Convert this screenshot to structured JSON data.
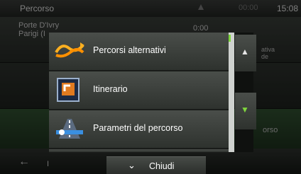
{
  "status_bar": {
    "title": "Percorso",
    "time": "15:08",
    "distance": "00:00"
  },
  "background": {
    "origin_line1": "Porte D'Ivry",
    "origin_line2": "Parigi (I",
    "time_value": "0:00",
    "side_text_1a": "ativa",
    "side_text_1b": "de",
    "side_text_2": "orso",
    "bottom_text": "I"
  },
  "menu": {
    "items": [
      {
        "label": "Percorsi alternativi",
        "icon": "alternative-routes-icon"
      },
      {
        "label": "Itinerario",
        "icon": "itinerary-icon"
      },
      {
        "label": "Parametri del percorso",
        "icon": "route-settings-icon"
      }
    ]
  },
  "scroll": {
    "up_icon": "chevron-up-icon",
    "down_icon": "chevron-down-icon"
  },
  "close_button": {
    "label": "Chiudi",
    "icon": "chevron-down-icon"
  },
  "colors": {
    "accent": "#7fd63d",
    "menu_bg": "#3a3e3a",
    "text": "#ffffff"
  }
}
